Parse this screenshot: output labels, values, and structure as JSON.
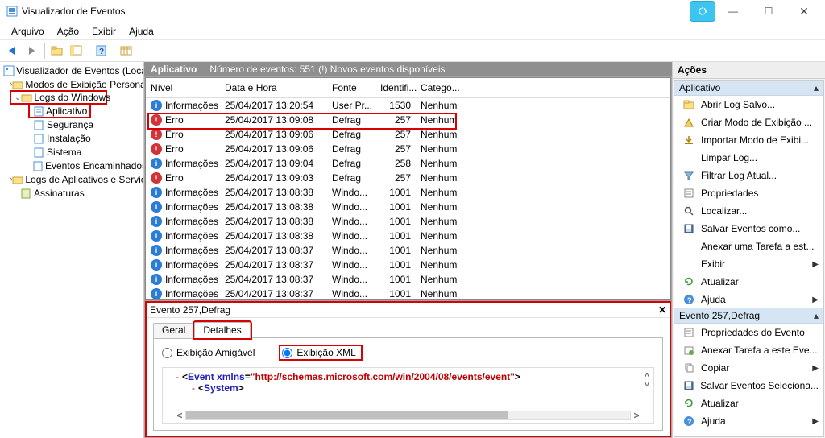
{
  "window": {
    "title": "Visualizador de Eventos"
  },
  "menu": {
    "arquivo": "Arquivo",
    "acao": "Ação",
    "exibir": "Exibir",
    "ajuda": "Ajuda"
  },
  "tree": {
    "root": "Visualizador de Eventos (Local)",
    "modos": "Modos de Exibição Personali",
    "logs": "Logs do Windows",
    "aplicativo": "Aplicativo",
    "seguranca": "Segurança",
    "instalacao": "Instalação",
    "sistema": "Sistema",
    "enc": "Eventos Encaminhados",
    "logsapp": "Logs de Aplicativos e Serviço",
    "assin": "Assinaturas"
  },
  "header": {
    "title": "Aplicativo",
    "summary": "Número de eventos: 551 (!) Novos eventos disponíveis"
  },
  "columns": {
    "nivel": "Nível",
    "data": "Data e Hora",
    "fonte": "Fonte",
    "id": "Identifi...",
    "cat": "Catego..."
  },
  "rows": [
    {
      "lvl": "info",
      "t": "Informações",
      "d": "25/04/2017 13:20:54",
      "s": "User Pr...",
      "i": "1530",
      "c": "Nenhum"
    },
    {
      "lvl": "err",
      "t": "Erro",
      "d": "25/04/2017 13:09:08",
      "s": "Defrag",
      "i": "257",
      "c": "Nenhum"
    },
    {
      "lvl": "err",
      "t": "Erro",
      "d": "25/04/2017 13:09:06",
      "s": "Defrag",
      "i": "257",
      "c": "Nenhum"
    },
    {
      "lvl": "err",
      "t": "Erro",
      "d": "25/04/2017 13:09:06",
      "s": "Defrag",
      "i": "257",
      "c": "Nenhum"
    },
    {
      "lvl": "info",
      "t": "Informações",
      "d": "25/04/2017 13:09:04",
      "s": "Defrag",
      "i": "258",
      "c": "Nenhum"
    },
    {
      "lvl": "err",
      "t": "Erro",
      "d": "25/04/2017 13:09:03",
      "s": "Defrag",
      "i": "257",
      "c": "Nenhum"
    },
    {
      "lvl": "info",
      "t": "Informações",
      "d": "25/04/2017 13:08:38",
      "s": "Windo...",
      "i": "1001",
      "c": "Nenhum"
    },
    {
      "lvl": "info",
      "t": "Informações",
      "d": "25/04/2017 13:08:38",
      "s": "Windo...",
      "i": "1001",
      "c": "Nenhum"
    },
    {
      "lvl": "info",
      "t": "Informações",
      "d": "25/04/2017 13:08:38",
      "s": "Windo...",
      "i": "1001",
      "c": "Nenhum"
    },
    {
      "lvl": "info",
      "t": "Informações",
      "d": "25/04/2017 13:08:38",
      "s": "Windo...",
      "i": "1001",
      "c": "Nenhum"
    },
    {
      "lvl": "info",
      "t": "Informações",
      "d": "25/04/2017 13:08:37",
      "s": "Windo...",
      "i": "1001",
      "c": "Nenhum"
    },
    {
      "lvl": "info",
      "t": "Informações",
      "d": "25/04/2017 13:08:37",
      "s": "Windo...",
      "i": "1001",
      "c": "Nenhum"
    },
    {
      "lvl": "info",
      "t": "Informações",
      "d": "25/04/2017 13:08:37",
      "s": "Windo...",
      "i": "1001",
      "c": "Nenhum"
    },
    {
      "lvl": "info",
      "t": "Informações",
      "d": "25/04/2017 13:08:37",
      "s": "Windo...",
      "i": "1001",
      "c": "Nenhum"
    }
  ],
  "detail": {
    "title": "Evento 257,Defrag",
    "tab_geral": "Geral",
    "tab_detalhes": "Detalhes",
    "radio_am": "Exibição Amigável",
    "radio_xml": "Exibição XML",
    "xml_event": "Event",
    "xml_xmlns": "xmlns",
    "xml_ns": "\"http://schemas.microsoft.com/win/2004/08/events/event\"",
    "xml_system": "System"
  },
  "actions": {
    "header": "Ações",
    "sec1": "Aplicativo",
    "items1": [
      {
        "icon": "open",
        "label": "Abrir Log Salvo..."
      },
      {
        "icon": "view",
        "label": "Criar Modo de Exibição ..."
      },
      {
        "icon": "import",
        "label": "Importar Modo de Exibi..."
      },
      {
        "icon": "",
        "label": "Limpar Log..."
      },
      {
        "icon": "filter",
        "label": "Filtrar Log Atual..."
      },
      {
        "icon": "props",
        "label": "Propriedades"
      },
      {
        "icon": "find",
        "label": "Localizar..."
      },
      {
        "icon": "save",
        "label": "Salvar Eventos como..."
      },
      {
        "icon": "",
        "label": "Anexar uma Tarefa a est..."
      },
      {
        "icon": "",
        "label": "Exibir",
        "arrow": true
      },
      {
        "icon": "refresh",
        "label": "Atualizar"
      },
      {
        "icon": "help",
        "label": "Ajuda",
        "arrow": true
      }
    ],
    "sec2": "Evento 257,Defrag",
    "items2": [
      {
        "icon": "props",
        "label": "Propriedades do Evento"
      },
      {
        "icon": "task",
        "label": "Anexar Tarefa a este Eve..."
      },
      {
        "icon": "copy",
        "label": "Copiar",
        "arrow": true
      },
      {
        "icon": "save",
        "label": "Salvar Eventos Seleciona..."
      },
      {
        "icon": "refresh",
        "label": "Atualizar"
      },
      {
        "icon": "help",
        "label": "Ajuda",
        "arrow": true
      }
    ]
  }
}
